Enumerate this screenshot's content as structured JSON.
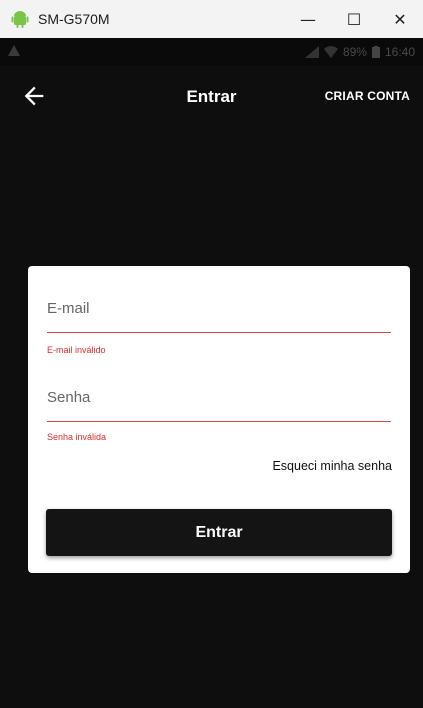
{
  "window": {
    "title": "SM-G570M",
    "controls": {
      "minimize": "—",
      "maximize": "☐",
      "close": "✕"
    }
  },
  "statusbar": {
    "left_icon": "warning-icon",
    "battery": "89%",
    "time": "16:40"
  },
  "appbar": {
    "back_icon": "arrow-left-icon",
    "title": "Entrar",
    "action": "CRIAR CONTA"
  },
  "form": {
    "email": {
      "label": "E-mail",
      "error": "E-mail inválido"
    },
    "password": {
      "label": "Senha",
      "error": "Senha inválida"
    },
    "forgot": "Esqueci minha senha",
    "submit": "Entrar"
  },
  "colors": {
    "background": "#0e0e0e",
    "card": "#ffffff",
    "error": "#d32f2f",
    "button": "#141414"
  }
}
